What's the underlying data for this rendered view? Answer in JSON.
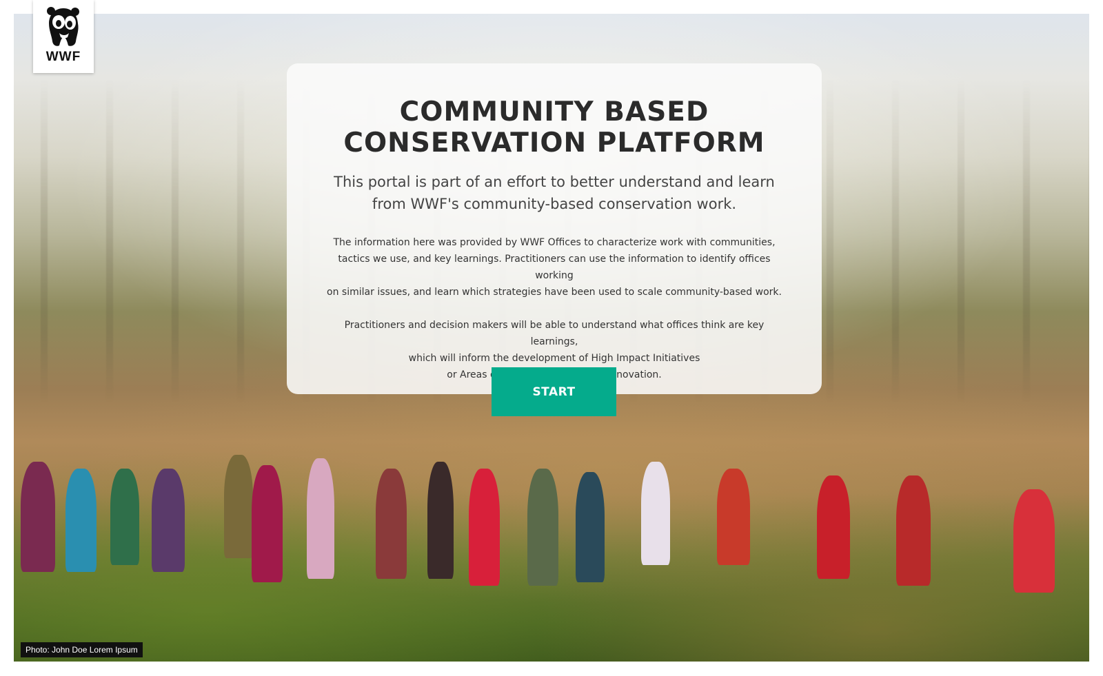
{
  "logo": {
    "icon": "panda-icon",
    "text": "WWF"
  },
  "hero": {
    "title_line1": "COMMUNITY BASED",
    "title_line2": "CONSERVATION PLATFORM",
    "subtitle": "This portal is part of an effort to better understand and learn from WWF's community-based conservation work.",
    "paragraph1": [
      "The information here was provided by WWF Offices to characterize work with communities,",
      "tactics we use, and key learnings.  Practitioners can use the information to identify offices working",
      "on similar issues, and learn which strategies have been used to scale community-based work."
    ],
    "paragraph2": [
      "Practitioners and decision makers will be able to understand what offices think are key learnings,",
      "which will inform the development of High Impact Initiatives",
      "or Areas of Collective Action and Innovation."
    ],
    "start_label": "START"
  },
  "photo_credit": "Photo: John Doe Lorem Ipsum",
  "colors": {
    "accent": "#05ab8c",
    "title": "#2b2b2b",
    "credit_bg": "#111111"
  }
}
